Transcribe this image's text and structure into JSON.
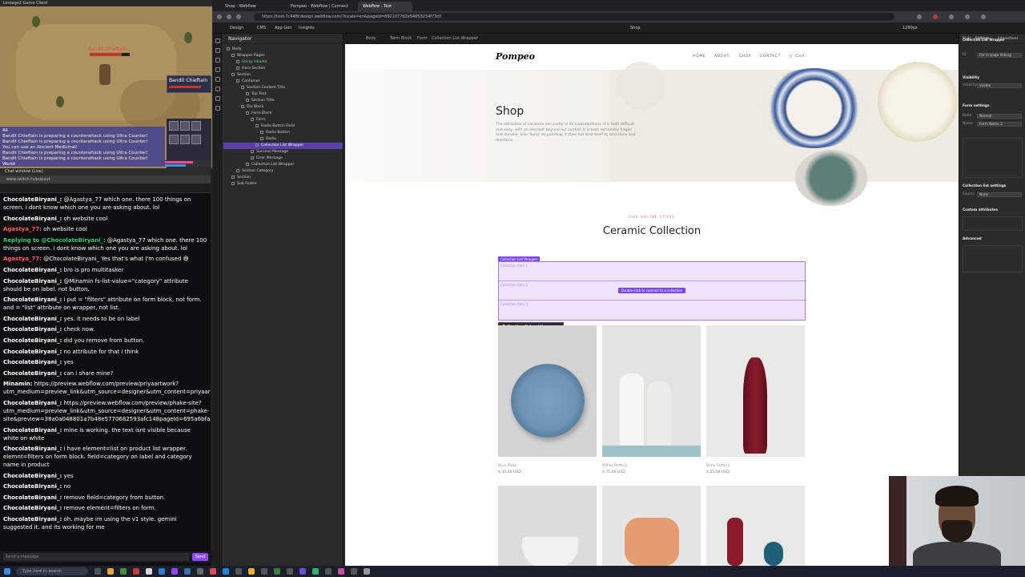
{
  "game": {
    "window_title": "Lineage2 Game Client",
    "target_name": "Bandit Chieftain",
    "chat_lines": [
      "Bandit Chieftain is preparing a counterattack using Ultra Counter!",
      "Bandit Chieftain is preparing a counterattack using Ultra Counter!",
      "You can use an Ancient Medicinal!",
      "Bandit Chieftain is preparing a counterattack using Ultra Counter!",
      "Bandit Chieftain is preparing a counterattack using Ultra Counter!"
    ],
    "chat_tab_all": "All",
    "chat_tab_world": "World"
  },
  "chat": {
    "tab_title": "Chat window (Live)",
    "url": "www.twitch.tv/popout",
    "input_placeholder": "Send a message",
    "send_label": "Send",
    "mention_tag": "@Minamin",
    "messages": [
      {
        "user": "ChocolateBiryani_:",
        "text": "@Agastya_77 which one. there 100 things on screen. i dont know which one you are asking about. lol",
        "style": "u"
      },
      {
        "user": "ChocolateBiryani_:",
        "text": "oh website cool",
        "style": "u"
      },
      {
        "user": "Agastya_77:",
        "text": "oh website cool",
        "style": "u2"
      },
      {
        "user": "Replying to @ChocolateBiryani_:",
        "text": "@Agastya_77 which one. there 100 things on screen. i dont know which one you are asking about. lol",
        "style": "u3"
      },
      {
        "user": "Agastya_77:",
        "text": "@ChocolateBiryani_ Yes that's what I'm confused 😅",
        "style": "u2"
      },
      {
        "user": "ChocolateBiryani_:",
        "text": "bro is pro multitasker",
        "style": "u"
      },
      {
        "user": "ChocolateBiryani_:",
        "text": "@Minamin fs-list-value=\"category\" attribute should be on label. not button.",
        "style": "u"
      },
      {
        "user": "ChocolateBiryani_:",
        "text": "i put = \"filters\" attribute on form block, not form. and = \"list\" attribute on wrapper, not list.",
        "style": "u"
      },
      {
        "user": "ChocolateBiryani_:",
        "text": "yes. it needs to be on label",
        "style": "u"
      },
      {
        "user": "ChocolateBiryani_:",
        "text": "check now.",
        "style": "u"
      },
      {
        "user": "ChocolateBiryani_:",
        "text": "did you remove from button.",
        "style": "u"
      },
      {
        "user": "ChocolateBiryani_:",
        "text": "no attribute for that i think",
        "style": "u"
      },
      {
        "user": "ChocolateBiryani_:",
        "text": "yes",
        "style": "u"
      },
      {
        "user": "ChocolateBiryani_:",
        "text": "can i share mine?",
        "style": "u"
      },
      {
        "user": "Minamin:",
        "text": "https://preview.webflow.com/preview/priyaartwork?utm_medium=preview_link&utm_source=designer&utm_content=priyaartwork&preview=3247ba99e257f9bf992e3d1303bdd0518pageId=694299e568be4cbb7534b134&locale=en&workflow=preview",
        "style": "u"
      },
      {
        "user": "ChocolateBiryani_:",
        "text": "https://preview.webflow.com/preview/phake-site?utm_medium=preview_link&utm_source=designer&utm_content=phake-site&preview=38a0a048801a7b48e5770682593afc148pageId=695a6bfa390e5e0c94cbcad28locale=en&workflow=preview",
        "style": "u"
      },
      {
        "user": "ChocolateBiryani_:",
        "text": "mine is working. the text isnt visible because white on white",
        "style": "u"
      },
      {
        "user": "ChocolateBiryani_:",
        "text": "i have element=list on product list wrapper. elemnt=filters on form block. field=category on label and category name in product",
        "style": "u"
      },
      {
        "user": "ChocolateBiryani_:",
        "text": "yes",
        "style": "u"
      },
      {
        "user": "ChocolateBiryani_:",
        "text": "no",
        "style": "u"
      },
      {
        "user": "ChocolateBiryani_:",
        "text": "remove field=category from button.",
        "style": "u"
      },
      {
        "user": "ChocolateBiryani_:",
        "text": "remove element=filters on form.",
        "style": "u"
      },
      {
        "user": "ChocolateBiryani_:",
        "text": "oh. maybe im using the v1 style. gemini suggested it. and its working for me",
        "style": "u"
      }
    ]
  },
  "taskbar": {
    "search_placeholder": "Type here to search"
  },
  "browser": {
    "tabs": [
      "Shop - Webflow",
      "Pompeo - Webflow | Connect",
      "Webflow - Test"
    ],
    "url": "https://test-7c448f.design.webflow.com/?locale=en&pageId=6921077d2e54053234f73c0"
  },
  "webflow": {
    "top_items": [
      "Design",
      "CMS",
      "App Gen",
      "Insights",
      "Shop"
    ],
    "breadcrumb": [
      "Body",
      "Term Block",
      "Form",
      "Collection List Wrapper"
    ],
    "zoom": "1280px",
    "navigator_title": "Navigator",
    "tree": [
      {
        "label": "Body",
        "indent": 0,
        "kind": "normal"
      },
      {
        "label": "Wrapper Pages",
        "indent": 1,
        "kind": "normal"
      },
      {
        "label": "Sticky Header",
        "indent": 2,
        "kind": "green"
      },
      {
        "label": "Hero Section",
        "indent": 2,
        "kind": "normal"
      },
      {
        "label": "Section",
        "indent": 1,
        "kind": "normal"
      },
      {
        "label": "Container",
        "indent": 2,
        "kind": "normal"
      },
      {
        "label": "Section Content Title",
        "indent": 3,
        "kind": "normal"
      },
      {
        "label": "Top Text",
        "indent": 4,
        "kind": "normal"
      },
      {
        "label": "Section Title",
        "indent": 4,
        "kind": "normal"
      },
      {
        "label": "Div Block",
        "indent": 3,
        "kind": "normal"
      },
      {
        "label": "Form Block",
        "indent": 4,
        "kind": "normal"
      },
      {
        "label": "Form",
        "indent": 5,
        "kind": "normal"
      },
      {
        "label": "Radio Button Field",
        "indent": 6,
        "kind": "normal"
      },
      {
        "label": "Radio Button",
        "indent": 7,
        "kind": "normal"
      },
      {
        "label": "Radio",
        "indent": 7,
        "kind": "normal"
      },
      {
        "label": "Collection List Wrapper",
        "indent": 6,
        "kind": "sel"
      },
      {
        "label": "Success Message",
        "indent": 5,
        "kind": "normal"
      },
      {
        "label": "Error Message",
        "indent": 5,
        "kind": "normal"
      },
      {
        "label": "Collection List Wrapper",
        "indent": 4,
        "kind": "normal"
      },
      {
        "label": "Section Category",
        "indent": 2,
        "kind": "normal"
      },
      {
        "label": "Section",
        "indent": 1,
        "kind": "normal"
      },
      {
        "label": "Sub Footer",
        "indent": 1,
        "kind": "normal"
      }
    ],
    "panel": {
      "tabs": [
        "Style",
        "Settings",
        "Interactions"
      ],
      "collection_wrapper_title": "Collection List Wrapper",
      "id_label": "ID",
      "id_placeholder": "For in-page linking",
      "visibility_label": "Visibility",
      "visibility_value": "Visible",
      "form_settings": "Form settings",
      "state_label": "State",
      "state_value": "Normal",
      "name_label": "Name",
      "name_value": "Form Name 2",
      "collection_list_settings": "Collection list settings",
      "source_label": "Source",
      "source_value": "None",
      "custom_attributes": "Custom attributes",
      "advanced": "Advanced"
    }
  },
  "site": {
    "logo": "Pompeo",
    "nav": [
      "HOME",
      "ABOUT",
      "SHOP",
      "CONTACT"
    ],
    "cart": "Cart",
    "hero_title": "Shop",
    "hero_desc": "The attraction of ceramics lies partly in its contradictions. It is both difficult and easy, with an element beyond our control. It is both extremely fragile and durable. Like 'Suna' on painting, it does not lend itself to omissions and deletions.",
    "eyebrow": "OUR ONLINE STORE",
    "section_title": "Ceramic Collection",
    "cl_tag": "Collection List Wrapper",
    "cl_rows": [
      "Collection item 1",
      "Collection item 2",
      "Collection item 3"
    ],
    "cl_hint": "Double-click to connect to a collection",
    "popup": {
      "title": "Collection list settings",
      "source_label": "Source",
      "source_value": "None",
      "button": "Show All Settings"
    },
    "products": [
      {
        "name": "Blue Plate",
        "price": "$ 35.00 USD"
      },
      {
        "name": "White Pottery",
        "price": "$ 75.00 USD"
      },
      {
        "name": "Wine Pottery",
        "price": "$ 55.00 USD"
      }
    ]
  },
  "colors": {
    "accent": "#7a47e6",
    "twitch": "#9147ff",
    "plate_blue": "#6d93b5",
    "vase_red": "#8b1a2b",
    "dish_orange": "#e39b6f"
  }
}
